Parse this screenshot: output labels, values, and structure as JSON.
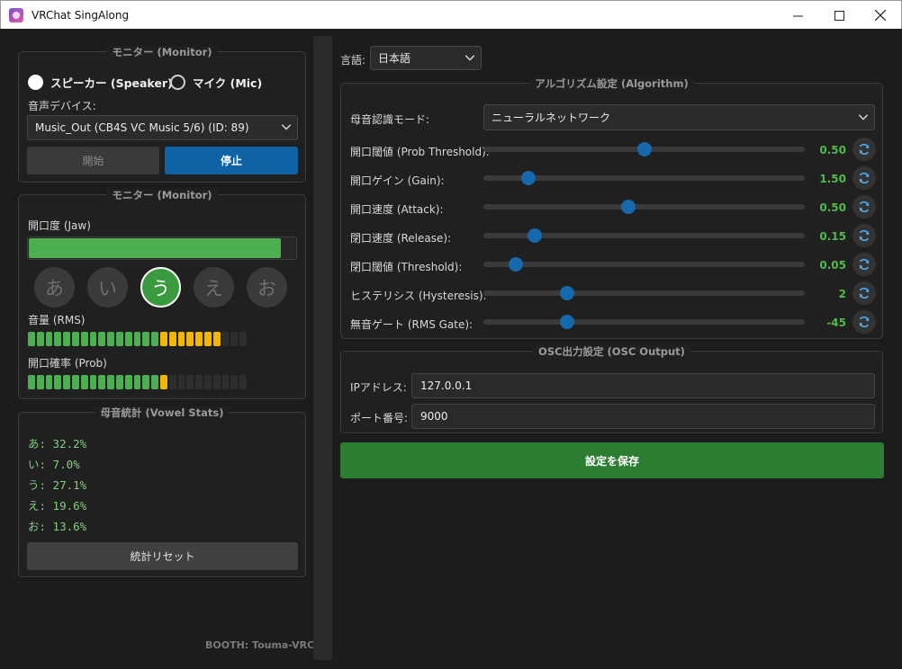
{
  "window": {
    "title": "VRChat SingAlong"
  },
  "left": {
    "source_group": {
      "title": "モニター (Monitor)",
      "speaker_label": "スピーカー (Speaker)",
      "mic_label": "マイク (Mic)",
      "device_label": "音声デバイス:",
      "device_value": "Music_Out (CB4S VC Music 5/6) (ID: 89)",
      "start_label": "開始",
      "stop_label": "停止"
    },
    "monitor_group": {
      "title": "モニター (Monitor)",
      "jaw_label": "開口度 (Jaw)",
      "jaw_level": 0.94,
      "vowels": [
        "あ",
        "い",
        "う",
        "え",
        "お"
      ],
      "active_vowel": 2,
      "rms_label": "音量 (RMS)",
      "rms_meter": {
        "total": 25,
        "green": 15,
        "yellow": 7
      },
      "prob_label": "開口確率 (Prob)",
      "prob_meter": {
        "total": 25,
        "green": 15,
        "yellow": 1
      }
    },
    "stats_group": {
      "title": "母音統計 (Vowel Stats)",
      "lines": [
        "あ: 32.2%",
        "い: 7.0%",
        "う: 27.1%",
        "え: 19.6%",
        "お: 13.6%"
      ],
      "reset_label": "統計リセット"
    },
    "footer": "BOOTH: Touma-VRC"
  },
  "right": {
    "language_label": "言語:",
    "language_value": "日本語",
    "algorithm": {
      "title": "アルゴリズム設定 (Algorithm)",
      "mode_label": "母音認識モード:",
      "mode_value": "ニューラルネットワーク",
      "sliders": [
        {
          "label": "開口閾値 (Prob Threshold):",
          "value": "0.50",
          "level": 0.5
        },
        {
          "label": "開口ゲイン (Gain):",
          "value": "1.50",
          "level": 0.14
        },
        {
          "label": "開口速度 (Attack):",
          "value": "0.50",
          "level": 0.45
        },
        {
          "label": "閉口速度 (Release):",
          "value": "0.15",
          "level": 0.16
        },
        {
          "label": "閉口閾値 (Threshold):",
          "value": "0.05",
          "level": 0.1
        },
        {
          "label": "ヒステリシス (Hysteresis):",
          "value": "2",
          "level": 0.26
        },
        {
          "label": "無音ゲート (RMS Gate):",
          "value": "-45",
          "level": 0.26
        }
      ]
    },
    "osc": {
      "title": "OSC出力設定 (OSC Output)",
      "ip_label": "IPアドレス:",
      "ip_value": "127.0.0.1",
      "port_label": "ポート番号:",
      "port_value": "9000"
    },
    "save_label": "設定を保存"
  },
  "colors": {
    "accent_blue": "#0e63a6",
    "accent_green": "#4caf50",
    "meter_yellow": "#f2b705",
    "save_green": "#2c7d32"
  }
}
